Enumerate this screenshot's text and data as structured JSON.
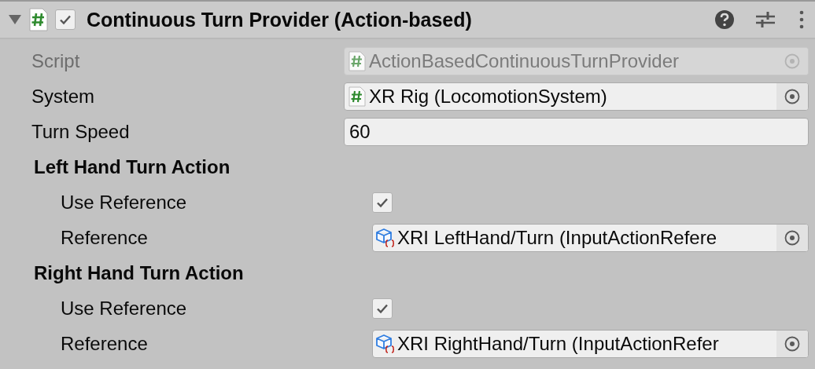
{
  "component": {
    "title": "Continuous Turn Provider (Action-based)",
    "expanded": true,
    "enabled": true
  },
  "fields": [
    {
      "kind": "script",
      "label": "Script",
      "value": "ActionBasedContinuousTurnProvider",
      "disabled": true
    },
    {
      "kind": "object",
      "label": "System",
      "value": "XR Rig (LocomotionSystem)",
      "disabled": false
    },
    {
      "kind": "number",
      "label": "Turn Speed",
      "value": "60",
      "disabled": false
    },
    {
      "kind": "group",
      "label": "Left Hand Turn Action",
      "children": [
        {
          "kind": "toggle",
          "label": "Use Reference",
          "checked": true,
          "disabled": false
        },
        {
          "kind": "asset",
          "label": "Reference",
          "value": "XRI LeftHand/Turn (InputActionRefere",
          "disabled": false
        }
      ]
    },
    {
      "kind": "group",
      "label": "Right Hand Turn Action",
      "children": [
        {
          "kind": "toggle",
          "label": "Use Reference",
          "checked": true,
          "disabled": false
        },
        {
          "kind": "asset",
          "label": "Reference",
          "value": "XRI RightHand/Turn (InputActionRefer",
          "disabled": false
        }
      ]
    }
  ]
}
